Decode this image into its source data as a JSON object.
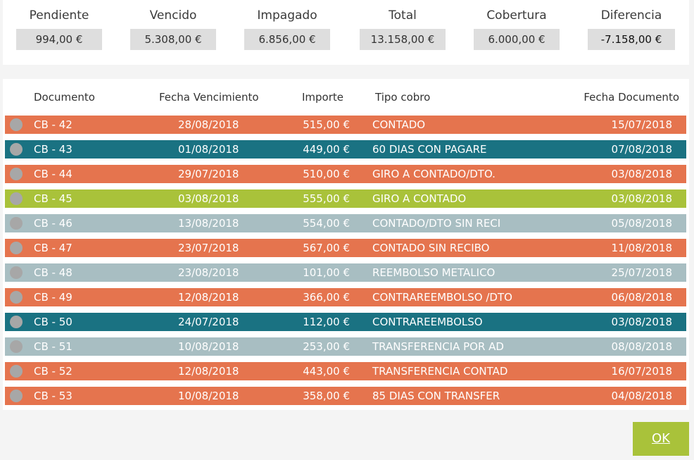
{
  "summary": [
    {
      "label": "Pendiente",
      "value": "994,00 €"
    },
    {
      "label": "Vencido",
      "value": "5.308,00 €"
    },
    {
      "label": "Impagado",
      "value": "6.856,00 €"
    },
    {
      "label": "Total",
      "value": "13.158,00 €"
    },
    {
      "label": "Cobertura",
      "value": "6.000,00 €"
    },
    {
      "label": "Diferencia",
      "value": "-7.158,00 €"
    }
  ],
  "table": {
    "headers": {
      "documento": "Documento",
      "fecha_vencimiento": "Fecha Vencimiento",
      "importe": "Importe",
      "tipo_cobro": "Tipo cobro",
      "fecha_documento": "Fecha Documento"
    },
    "status_colors": {
      "orange": "#e5744e",
      "teal": "#1a7282",
      "green": "#a9c23a",
      "gray": "#a8bec2"
    },
    "rows": [
      {
        "documento": "CB - 42",
        "vencimiento": "28/08/2018",
        "importe": "515,00 €",
        "tipo": "CONTADO",
        "fecha_doc": "15/07/2018",
        "color": "#e5744e"
      },
      {
        "documento": "CB - 43",
        "vencimiento": "01/08/2018",
        "importe": "449,00 €",
        "tipo": "60 DIAS CON PAGARE",
        "fecha_doc": "07/08/2018",
        "color": "#1a7282"
      },
      {
        "documento": "CB - 44",
        "vencimiento": "29/07/2018",
        "importe": "510,00 €",
        "tipo": "GIRO A CONTADO/DTO.",
        "fecha_doc": "03/08/2018",
        "color": "#e5744e"
      },
      {
        "documento": "CB - 45",
        "vencimiento": "03/08/2018",
        "importe": "555,00 €",
        "tipo": "GIRO A CONTADO",
        "fecha_doc": "03/08/2018",
        "color": "#a9c23a"
      },
      {
        "documento": "CB - 46",
        "vencimiento": "13/08/2018",
        "importe": "554,00 €",
        "tipo": "CONTADO/DTO SIN RECI",
        "fecha_doc": "05/08/2018",
        "color": "#a8bec2"
      },
      {
        "documento": "CB - 47",
        "vencimiento": "23/07/2018",
        "importe": "567,00 €",
        "tipo": "CONTADO SIN RECIBO",
        "fecha_doc": "11/08/2018",
        "color": "#e5744e"
      },
      {
        "documento": "CB - 48",
        "vencimiento": "23/08/2018",
        "importe": "101,00 €",
        "tipo": "REEMBOLSO METALICO",
        "fecha_doc": "25/07/2018",
        "color": "#a8bec2"
      },
      {
        "documento": "CB - 49",
        "vencimiento": "12/08/2018",
        "importe": "366,00 €",
        "tipo": "CONTRAREEMBOLSO /DTO",
        "fecha_doc": "06/08/2018",
        "color": "#e5744e"
      },
      {
        "documento": "CB - 50",
        "vencimiento": "24/07/2018",
        "importe": "112,00 €",
        "tipo": "CONTRAREEMBOLSO",
        "fecha_doc": "03/08/2018",
        "color": "#1a7282"
      },
      {
        "documento": "CB - 51",
        "vencimiento": "10/08/2018",
        "importe": "253,00 €",
        "tipo": "TRANSFERENCIA POR AD",
        "fecha_doc": "08/08/2018",
        "color": "#a8bec2"
      },
      {
        "documento": "CB - 52",
        "vencimiento": "12/08/2018",
        "importe": "443,00 €",
        "tipo": "TRANSFERENCIA CONTAD",
        "fecha_doc": "16/07/2018",
        "color": "#e5744e"
      },
      {
        "documento": "CB - 53",
        "vencimiento": "10/08/2018",
        "importe": "358,00 €",
        "tipo": "85 DIAS CON TRANSFER",
        "fecha_doc": "04/08/2018",
        "color": "#e5744e"
      }
    ]
  },
  "footer": {
    "ok_label": "OK",
    "ok_color": "#a9c23a"
  },
  "icons": {
    "row_status": "circle-icon"
  }
}
